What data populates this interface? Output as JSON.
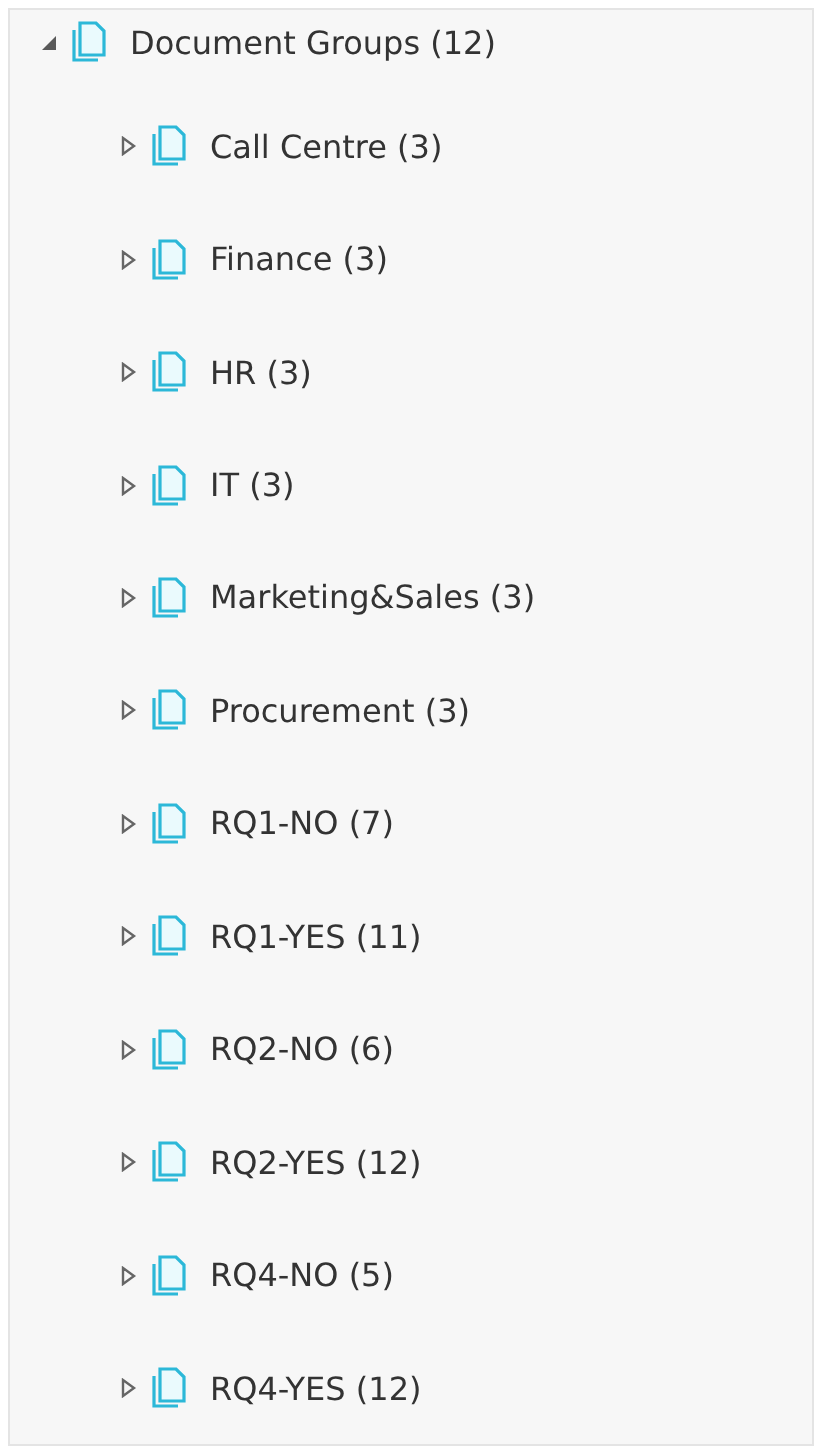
{
  "tree": {
    "label": "Document Groups (12)",
    "expanded": true,
    "children": [
      {
        "label": "Call Centre (3)",
        "expanded": false
      },
      {
        "label": "Finance (3)",
        "expanded": false
      },
      {
        "label": "HR (3)",
        "expanded": false
      },
      {
        "label": "IT (3)",
        "expanded": false
      },
      {
        "label": "Marketing&Sales (3)",
        "expanded": false
      },
      {
        "label": "Procurement (3)",
        "expanded": false
      },
      {
        "label": "RQ1-NO (7)",
        "expanded": false
      },
      {
        "label": "RQ1-YES (11)",
        "expanded": false
      },
      {
        "label": "RQ2-NO (6)",
        "expanded": false
      },
      {
        "label": "RQ2-YES (12)",
        "expanded": false
      },
      {
        "label": "RQ4-NO (5)",
        "expanded": false
      },
      {
        "label": "RQ4-YES (12)",
        "expanded": false
      }
    ]
  }
}
